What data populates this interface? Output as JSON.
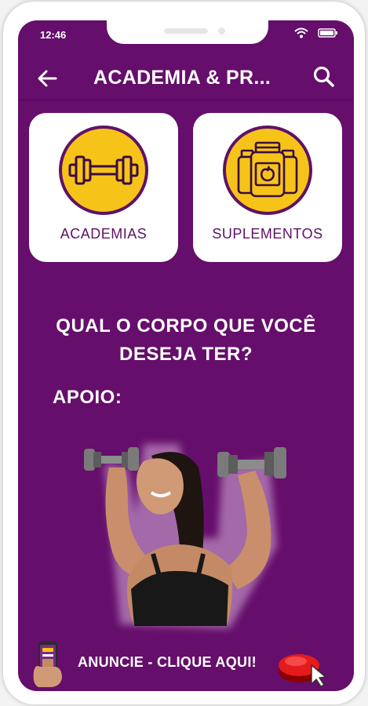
{
  "status_bar": {
    "time": "12:46",
    "icons": [
      "wifi-icon",
      "battery-icon"
    ]
  },
  "app_bar": {
    "title": "ACADEMIA & PR...",
    "back_icon": "arrow-left-icon",
    "search_icon": "search-icon"
  },
  "categories": [
    {
      "label": "ACADEMIAS",
      "icon": "dumbbell-icon"
    },
    {
      "label": "SUPLEMENTOS",
      "icon": "supplement-jars-icon"
    }
  ],
  "headline": {
    "line1": "QUAL O CORPO QUE VOCÊ",
    "line2": "DESEJA TER?"
  },
  "sponsor": {
    "heading": "APOIO:",
    "image": "woman-lifting-dumbbells-photo"
  },
  "ad_banner": {
    "text": "ANUNCIE - CLIQUE AQUI!",
    "left_icon": "phone-in-hand-icon",
    "right_icon": "red-button-with-cursor-icon"
  },
  "colors": {
    "background": "#650e6b",
    "card": "#ffffff",
    "icon_circle": "#f6c419",
    "accent_purple": "#5e1266",
    "text": "#ffffff"
  }
}
